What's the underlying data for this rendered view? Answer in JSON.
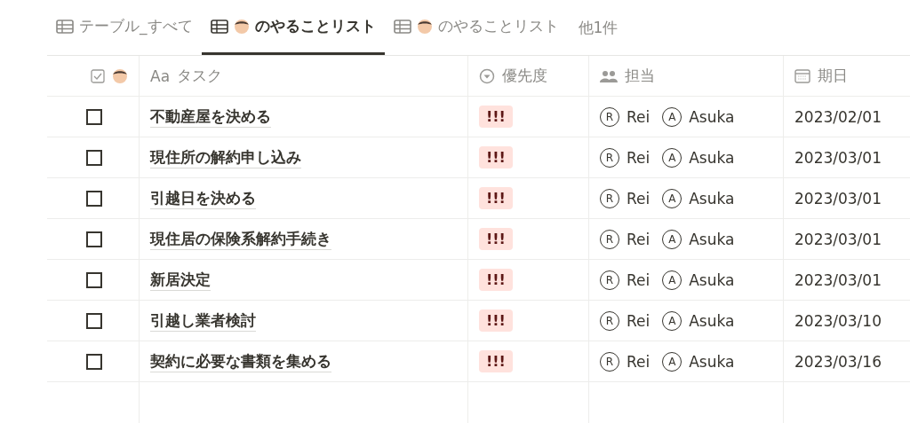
{
  "tabs": [
    {
      "label": "テーブル_すべて",
      "avatar": false,
      "selected": false
    },
    {
      "label": "のやることリスト",
      "avatar": true,
      "selected": true
    },
    {
      "label": "のやることリスト",
      "avatar": true,
      "selected": false
    }
  ],
  "more_tabs": "他1件",
  "table": {
    "columns": [
      {
        "kind": "check"
      },
      {
        "kind": "title",
        "label": "タスク",
        "prefix": "Aa"
      },
      {
        "kind": "select",
        "label": "優先度"
      },
      {
        "kind": "person",
        "label": "担当"
      },
      {
        "kind": "date",
        "label": "期日"
      }
    ],
    "rows": [
      {
        "done": false,
        "task": "不動産屋を決める",
        "priority": "!!!",
        "people": [
          {
            "initial": "R",
            "name": "Rei"
          },
          {
            "initial": "A",
            "name": "Asuka"
          }
        ],
        "date": "2023/02/01"
      },
      {
        "done": false,
        "task": "現住所の解約申し込み",
        "priority": "!!!",
        "people": [
          {
            "initial": "R",
            "name": "Rei"
          },
          {
            "initial": "A",
            "name": "Asuka"
          }
        ],
        "date": "2023/03/01"
      },
      {
        "done": false,
        "task": "引越日を決める",
        "priority": "!!!",
        "people": [
          {
            "initial": "R",
            "name": "Rei"
          },
          {
            "initial": "A",
            "name": "Asuka"
          }
        ],
        "date": "2023/03/01"
      },
      {
        "done": false,
        "task": "現住居の保険系解約手続き",
        "priority": "!!!",
        "people": [
          {
            "initial": "R",
            "name": "Rei"
          },
          {
            "initial": "A",
            "name": "Asuka"
          }
        ],
        "date": "2023/03/01"
      },
      {
        "done": false,
        "task": "新居決定",
        "priority": "!!!",
        "people": [
          {
            "initial": "R",
            "name": "Rei"
          },
          {
            "initial": "A",
            "name": "Asuka"
          }
        ],
        "date": "2023/03/01"
      },
      {
        "done": false,
        "task": "引越し業者検討",
        "priority": "!!!",
        "people": [
          {
            "initial": "R",
            "name": "Rei"
          },
          {
            "initial": "A",
            "name": "Asuka"
          }
        ],
        "date": "2023/03/10"
      },
      {
        "done": false,
        "task": "契約に必要な書類を集める",
        "priority": "!!!",
        "people": [
          {
            "initial": "R",
            "name": "Rei"
          },
          {
            "initial": "A",
            "name": "Asuka"
          }
        ],
        "date": "2023/03/16"
      }
    ]
  }
}
